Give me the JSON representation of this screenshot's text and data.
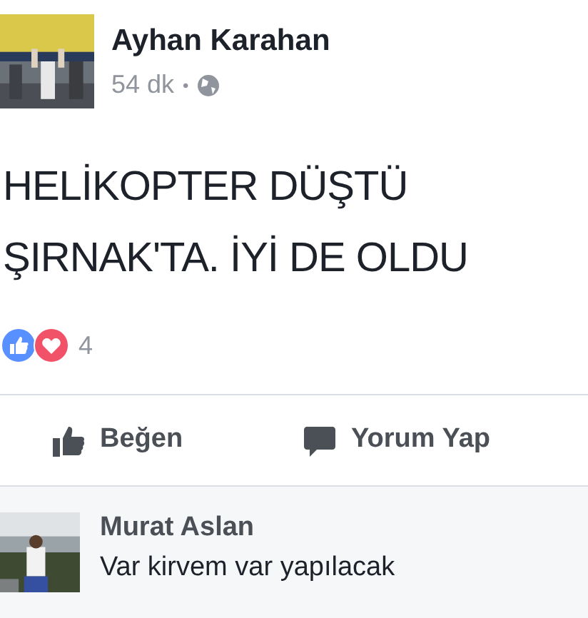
{
  "post": {
    "author": "Ayhan Karahan",
    "time": "54 dk",
    "separator": "•",
    "text": "HELİKOPTER DÜŞTÜ ŞIRNAK'TA. İYİ DE OLDU",
    "reaction_count": "4"
  },
  "actions": [
    {
      "kind": "like",
      "label": "Beğen"
    },
    {
      "kind": "comment",
      "label": "Yorum Yap"
    }
  ],
  "comments": [
    {
      "author": "Murat Aslan",
      "text": "Var kirvem var yapılacak"
    }
  ]
}
